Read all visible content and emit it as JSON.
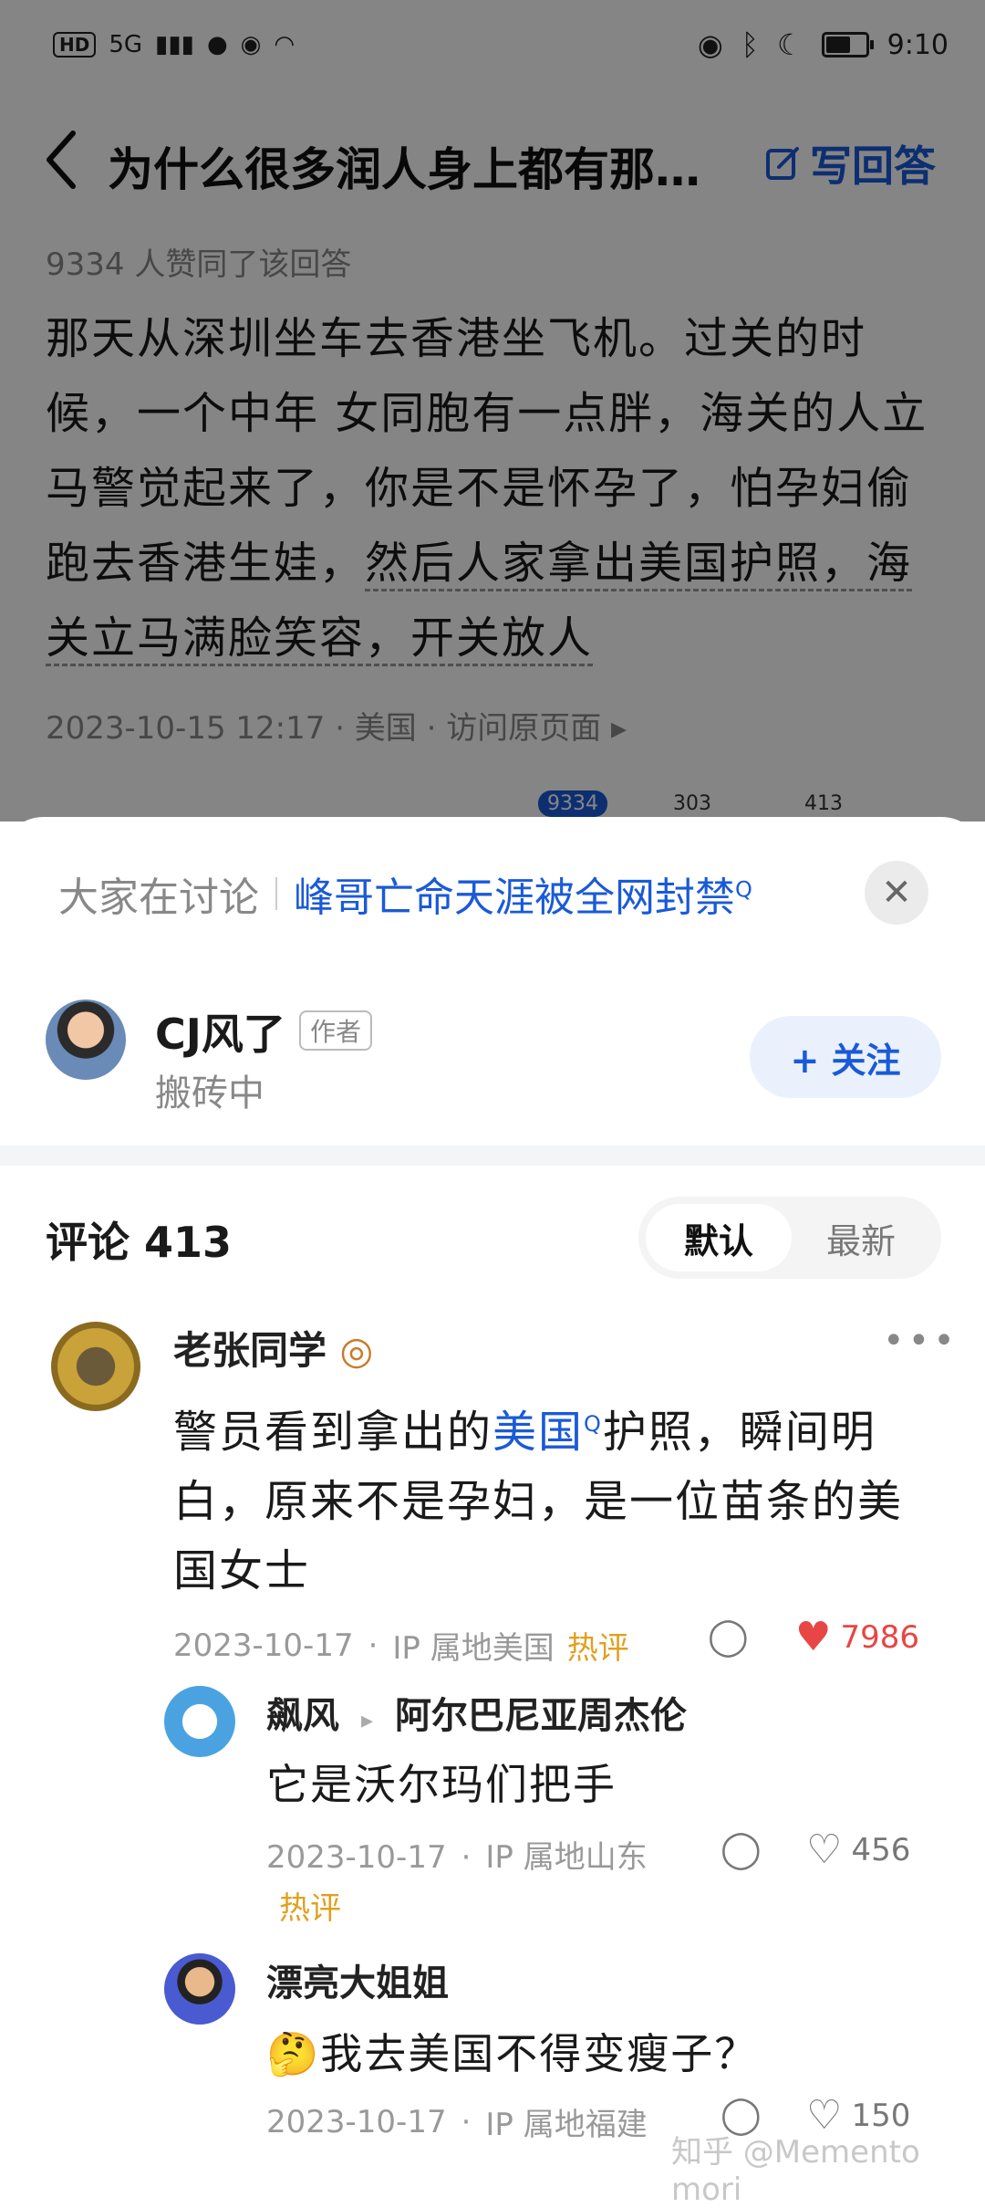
{
  "status_bar": {
    "left": [
      "HD",
      "5G",
      "📶"
    ],
    "time": "9:10"
  },
  "question": {
    "title": "为什么很多润人身上都有那…",
    "write_answer_label": "写回答"
  },
  "answer": {
    "likes_text": "9334 人赞同了该回答",
    "body_plain": "那天从深圳坐车去香港坐飞机。过关的时候，一个中年 女同胞有一点胖，海关的人立马警觉起来了，你是不是怀孕了，怕孕妇偷跑去香港生娃，",
    "body_highlight": "然后人家拿出美国护照，海关立马满脸笑容，开关放人",
    "footer": "2023-10-15 12:17 · 美国 · 访问原页面 ▸",
    "counts": [
      "9334",
      "303",
      "413"
    ]
  },
  "sheet": {
    "discuss_label": "大家在讨论",
    "discuss_topic": "峰哥亡命天涯被全网封禁",
    "author": {
      "name": "CJ风了",
      "tag": "作者",
      "bio": "搬砖中",
      "follow_label": "+ 关注"
    },
    "comments_title": "评论 413",
    "sort": {
      "default": "默认",
      "latest": "最新"
    },
    "comments": [
      {
        "name": "老张同学",
        "text_before": "警员看到拿出的",
        "text_link": "美国",
        "text_after": "护照，瞬间明白，原来不是孕妇，是一位苗条的美国女士",
        "date": "2023-10-17",
        "ip": "IP 属地美国",
        "hot": "热评",
        "likes": "7986"
      },
      {
        "name": "飙风",
        "reply_to": "阿尔巴尼亚周杰伦",
        "text": "它是沃尔玛们把手",
        "date": "2023-10-17",
        "ip": "IP 属地山东",
        "hot": "热评",
        "likes": "456"
      },
      {
        "name": "漂亮大姐姐",
        "emoji": "🤔",
        "text": "我去美国不得变瘦子？",
        "date": "2023-10-17",
        "ip": "IP 属地福建",
        "likes": "150"
      }
    ]
  },
  "watermark": "知乎 @Memento mori",
  "colors": {
    "accent": "#1a5ad8",
    "hot": "#e0a020",
    "like": "#e84545"
  }
}
